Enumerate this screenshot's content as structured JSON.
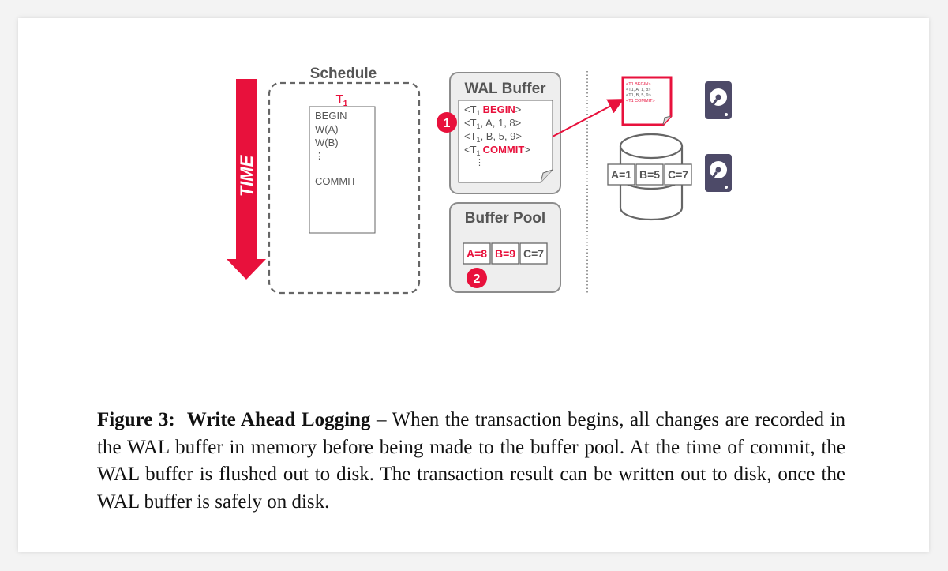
{
  "figure": {
    "schedule_title": "Schedule",
    "time_label": "TIME",
    "txn_name": "T",
    "txn_sub": "1",
    "schedule_ops": [
      "BEGIN",
      "W(A)",
      "W(B)",
      "⋮",
      "COMMIT"
    ],
    "wal_buffer_title": "WAL Buffer",
    "wal_records": [
      {
        "prefix": "<T",
        "sub": "1",
        "rest": ", A, 1, 8>",
        "keyword": ""
      },
      {
        "prefix": "<T",
        "sub": "1",
        "rest": ", B, 5, 9>",
        "keyword": ""
      }
    ],
    "wal_begin": {
      "prefix": "<T",
      "sub": "1",
      "keyword": "BEGIN",
      "suffix": ">"
    },
    "wal_commit": {
      "prefix": "<T",
      "sub": "1",
      "keyword": "COMMIT",
      "suffix": ">"
    },
    "wal_ellipsis": "⋮",
    "buffer_pool_title": "Buffer Pool",
    "buffer_pool_cells": [
      "A=8",
      "B=9",
      "C=7"
    ],
    "disk_cells": [
      "A=1",
      "B=5",
      "C=7"
    ],
    "disk_log_lines": [
      "<T1 BEGIN>",
      "<T1, A, 1, 8>",
      "<T1, B, 5, 9>",
      "<T1 COMMIT>"
    ],
    "step_1": "1",
    "step_2": "2",
    "colors": {
      "accent": "#e8113c",
      "box_fill": "#eeeeee",
      "box_border": "#8c8c8c",
      "text": "#555555",
      "disk_icon": "#4d4a68"
    }
  },
  "caption": {
    "label": "Figure 3:",
    "title": "Write Ahead Logging",
    "dash": "–",
    "text": "When the transaction begins, all changes are recorded in the WAL buffer in memory before being made to the buffer pool.  At the time of commit, the WAL buffer is flushed out to disk. The transaction result can be written out to disk, once the WAL buffer is safely on disk."
  }
}
